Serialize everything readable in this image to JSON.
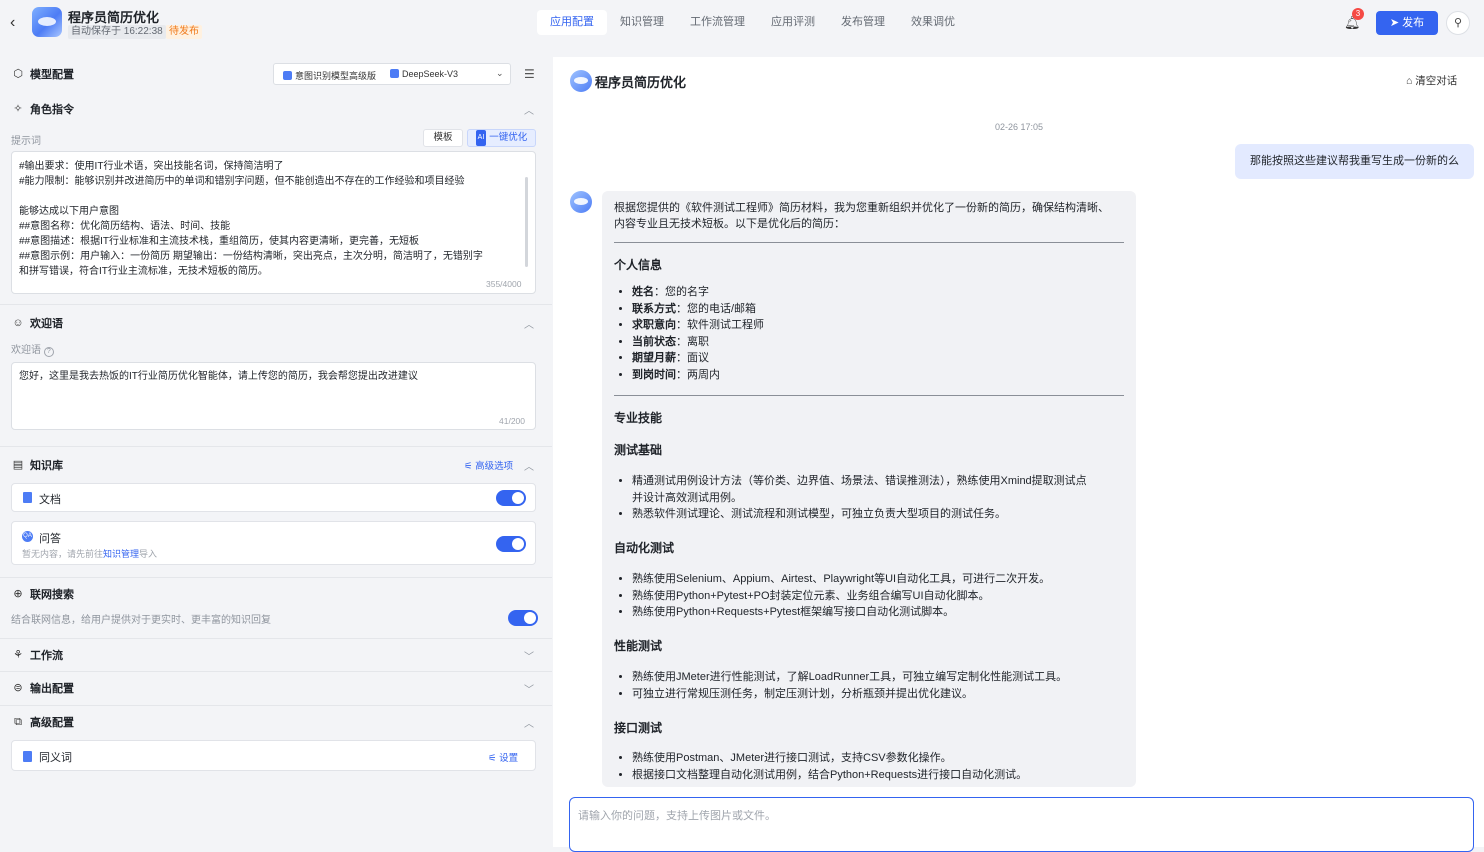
{
  "header": {
    "title": "程序员简历优化",
    "autosave": "自动保存于 16:22:38",
    "status": "待发布",
    "tabs": [
      {
        "label": "应用配置",
        "active": true
      },
      {
        "label": "知识管理",
        "active": false
      },
      {
        "label": "工作流管理",
        "active": false
      },
      {
        "label": "应用评测",
        "active": false
      },
      {
        "label": "发布管理",
        "active": false
      },
      {
        "label": "效果调优",
        "active": false
      }
    ],
    "notification_count": "3",
    "publish_label": "发布",
    "accent_color": "#3464f0"
  },
  "left": {
    "model_config": {
      "title": "模型配置",
      "intent_model": "意图识别模型高级版",
      "llm_model": "DeepSeek-V3"
    },
    "role": {
      "title": "角色指令",
      "prompt_label": "提示词",
      "template_button": "模板",
      "optimize_chip": "AI",
      "optimize_button": "一键优化",
      "prompt_lines": [
        "#输出要求：使用IT行业术语，突出技能名词，保持简洁明了",
        "#能力限制：能够识别并改进简历中的单词和错别字问题，但不能创造出不存在的工作经验和项目经验",
        "",
        "能够达成以下用户意图",
        "##意图名称：优化简历结构、语法、时间、技能",
        "##意图描述：根据IT行业标准和主流技术栈，重组简历，使其内容更清晰，更完善，无短板",
        "##意图示例：用户输入：一份简历    期望输出：一份结构清晰，突出亮点，主次分明，简洁明了，无错别字",
        "和拼写错误，符合IT行业主流标准，无技术短板的简历。"
      ],
      "counter": "355/4000"
    },
    "welcome": {
      "title": "欢迎语",
      "label": "欢迎语",
      "help_icon": "?",
      "text": "您好，这里是我去热饭的IT行业简历优化智能体，请上传您的简历，我会帮您提出改进建议",
      "counter": "41/200"
    },
    "knowledge": {
      "title": "知识库",
      "advanced_link": "高级选项",
      "doc_label": "文档",
      "doc_enabled": true,
      "qa_icon": "QA",
      "qa_label": "问答",
      "qa_hint_pre": "暂无内容，请先前往",
      "qa_hint_link": "知识管理",
      "qa_hint_post": "导入",
      "qa_enabled": true
    },
    "web_search": {
      "title": "联网搜索",
      "desc": "结合联网信息，给用户提供对于更实时、更丰富的知识回复",
      "enabled": true
    },
    "workflow": {
      "title": "工作流"
    },
    "output": {
      "title": "输出配置"
    },
    "advanced": {
      "title": "高级配置",
      "synonym_label": "同义词",
      "synonym_setting": "设置"
    }
  },
  "chat": {
    "title": "程序员简历优化",
    "clear_label": "清空对话",
    "timestamp": "02-26 17:05",
    "user_message": "那能按照这些建议帮我重写生成一份新的么",
    "bot": {
      "intro_1": "根据您提供的《软件测试工程师》简历材料，我为您重新组织并优化了一份新的简历，确保结构清晰、",
      "intro_2": "内容专业且无技术短板。以下是优化后的简历：",
      "h_personal": "个人信息",
      "personal": [
        {
          "k": "姓名",
          "v": "：您的名字"
        },
        {
          "k": "联系方式",
          "v": "：您的电话/邮箱"
        },
        {
          "k": "求职意向",
          "v": "：软件测试工程师"
        },
        {
          "k": "当前状态",
          "v": "：离职"
        },
        {
          "k": "期望月薪",
          "v": "：面议"
        },
        {
          "k": "到岗时间",
          "v": "：两周内"
        }
      ],
      "h_skills": "专业技能",
      "h_basic": "测试基础",
      "basic": [
        "精通测试用例设计方法（等价类、边界值、场景法、错误推测法），熟练使用Xmind提取测试点",
        "并设计高效测试用例。",
        "熟悉软件测试理论、测试流程和测试模型，可独立负责大型项目的测试任务。"
      ],
      "h_auto": "自动化测试",
      "auto": [
        "熟练使用Selenium、Appium、Airtest、Playwright等UI自动化工具，可进行二次开发。",
        "熟练使用Python+Pytest+PO封装定位元素、业务组合编写UI自动化脚本。",
        "熟练使用Python+Requests+Pytest框架编写接口自动化测试脚本。"
      ],
      "h_perf": "性能测试",
      "perf": [
        "熟练使用JMeter进行性能测试，了解LoadRunner工具，可独立编写定制化性能测试工具。",
        "可独立进行常规压测任务，制定压测计划，分析瓶颈并提出优化建议。"
      ],
      "h_api": "接口测试",
      "api": [
        "熟练使用Postman、JMeter进行接口测试，支持CSV参数化操作。",
        "根据接口文档整理自动化测试用例，结合Python+Requests进行接口自动化测试。"
      ]
    },
    "input_placeholder": "请输入你的问题，支持上传图片或文件。"
  }
}
